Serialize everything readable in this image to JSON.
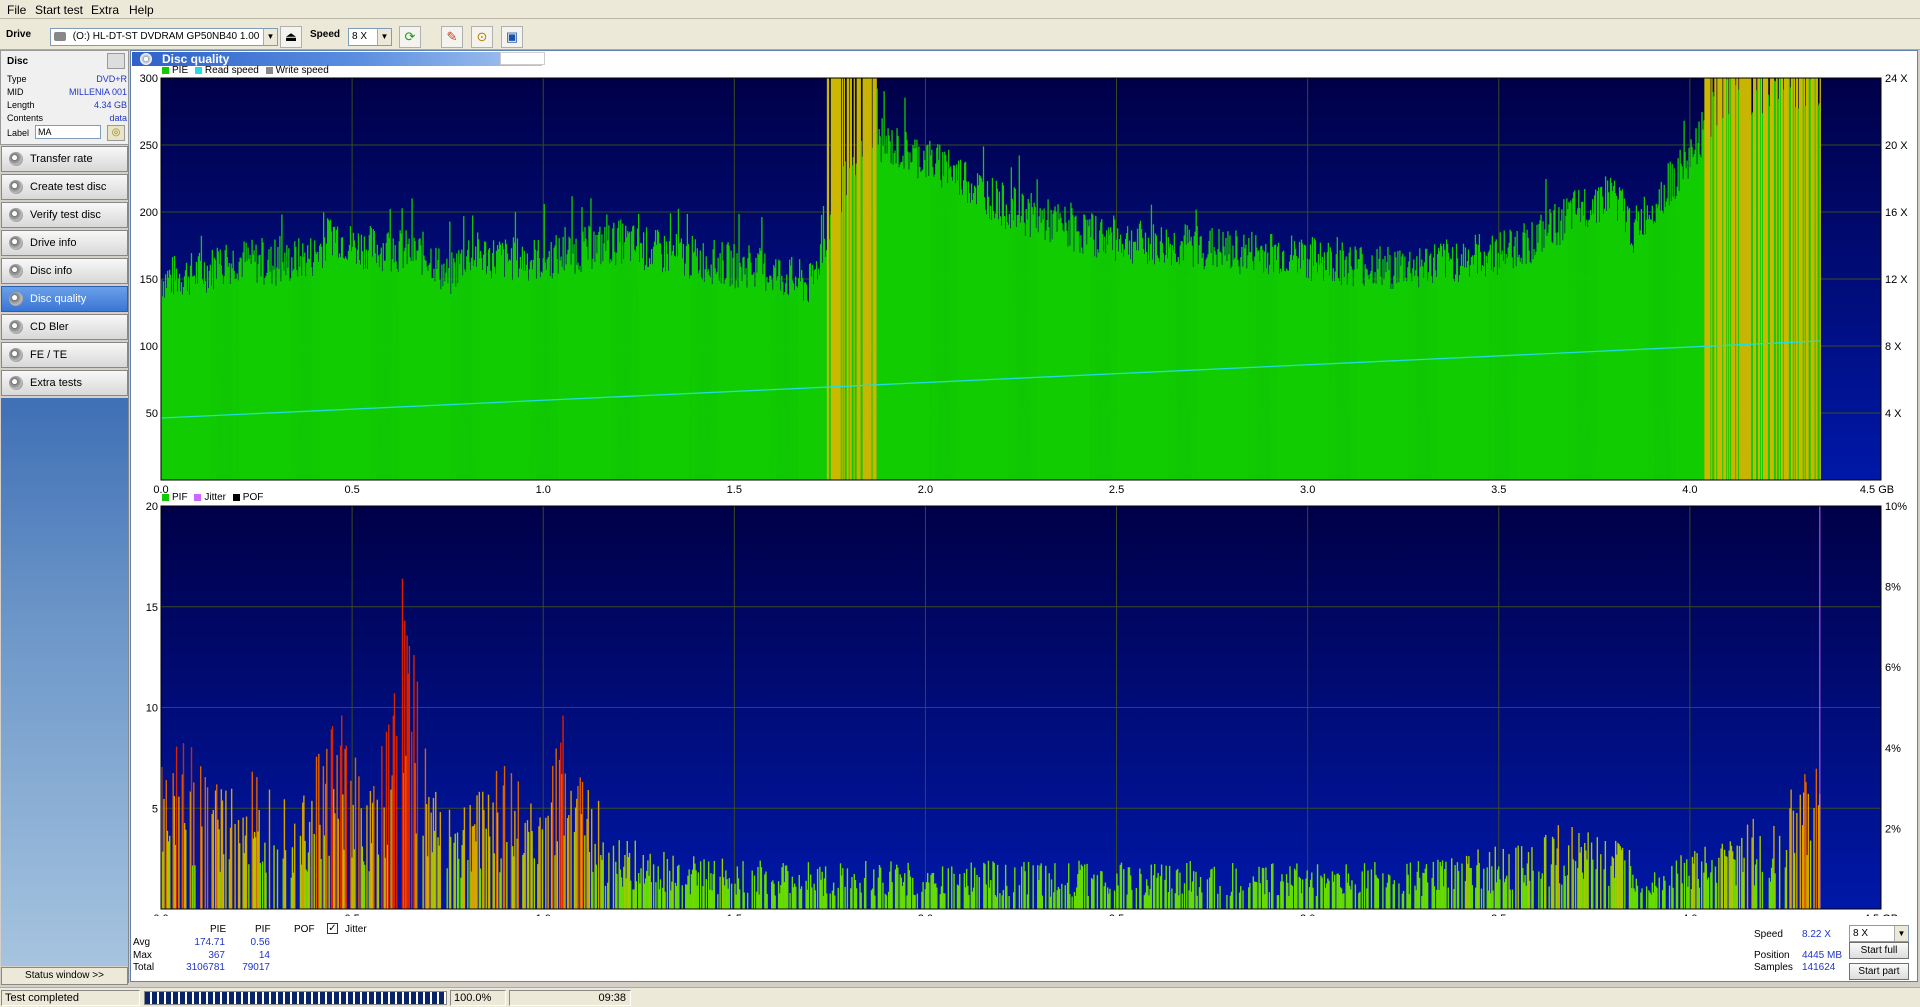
{
  "menu": {
    "file": "File",
    "start_test": "Start test",
    "extra": "Extra",
    "help": "Help"
  },
  "toolbar": {
    "drive_label": "Drive",
    "drive_value": "(O:)   HL-DT-ST DVDRAM GP50NB40 1.00",
    "speed_label": "Speed",
    "speed_value": "8 X"
  },
  "disc": {
    "header": "Disc",
    "rows": [
      {
        "key": "Type",
        "value": "DVD+R"
      },
      {
        "key": "MID",
        "value": "MILLENIA 001"
      },
      {
        "key": "Length",
        "value": "4.34 GB"
      },
      {
        "key": "Contents",
        "value": "data"
      }
    ],
    "label_key": "Label",
    "label_value": "MA"
  },
  "nav": [
    {
      "label": "Transfer rate",
      "active": false
    },
    {
      "label": "Create test disc",
      "active": false
    },
    {
      "label": "Verify test disc",
      "active": false
    },
    {
      "label": "Drive info",
      "active": false
    },
    {
      "label": "Disc info",
      "active": false
    },
    {
      "label": "Disc quality",
      "active": true
    },
    {
      "label": "CD Bler",
      "active": false
    },
    {
      "label": "FE / TE",
      "active": false
    },
    {
      "label": "Extra tests",
      "active": false
    }
  ],
  "status_window": "Status window >>",
  "panel_title": "Disc quality",
  "legend_top": [
    "PIE",
    "Read speed",
    "Write speed"
  ],
  "legend_bottom": [
    "PIF",
    "Jitter",
    "POF"
  ],
  "colors": {
    "pie": "#11cc00",
    "speed": "#22dddd",
    "write": "#888888",
    "bg": "#00005a",
    "pif_low": "#66dd00",
    "pif_high": "#dd2200",
    "jitter": "#cc66ff",
    "pof": "#000000",
    "yellow": "#ccb800"
  },
  "chart_data": [
    {
      "type": "area",
      "title": "PIE / Read speed",
      "x_ticks": [
        "0.0",
        "0.5",
        "1.0",
        "1.5",
        "2.0",
        "2.5",
        "3.0",
        "3.5",
        "4.0",
        "4.5 GB"
      ],
      "y_ticks_left": [
        "50",
        "100",
        "150",
        "200",
        "250",
        "300"
      ],
      "y_ticks_right": [
        "4 X",
        "8 X",
        "12 X",
        "16 X",
        "20 X",
        "24 X"
      ],
      "xlim": [
        0,
        4.5
      ],
      "ylim": [
        0,
        300
      ],
      "y2lim": [
        0,
        24
      ],
      "series": [
        {
          "name": "PIE",
          "x": [
            0.0,
            0.1,
            0.2,
            0.3,
            0.4,
            0.45,
            0.5,
            0.6,
            0.7,
            0.75,
            0.8,
            0.9,
            1.0,
            1.1,
            1.2,
            1.3,
            1.4,
            1.5,
            1.6,
            1.7,
            1.75,
            1.8,
            1.85,
            1.9,
            1.95,
            2.0,
            2.1,
            2.2,
            2.3,
            2.4,
            2.5,
            2.6,
            2.7,
            2.8,
            2.9,
            3.0,
            3.1,
            3.2,
            3.3,
            3.4,
            3.5,
            3.6,
            3.7,
            3.8,
            3.85,
            3.9,
            4.0,
            4.05,
            4.1,
            4.2,
            4.3,
            4.34
          ],
          "values": [
            150,
            155,
            165,
            160,
            168,
            185,
            175,
            172,
            168,
            150,
            170,
            165,
            165,
            172,
            178,
            170,
            165,
            160,
            155,
            145,
            195,
            230,
            260,
            250,
            245,
            240,
            225,
            205,
            195,
            185,
            180,
            175,
            175,
            170,
            170,
            165,
            162,
            158,
            160,
            165,
            170,
            180,
            200,
            215,
            185,
            205,
            240,
            270,
            285,
            290,
            290,
            285
          ]
        },
        {
          "name": "Read speed",
          "x": [
            0.0,
            4.34
          ],
          "values": [
            3.7,
            8.3
          ]
        }
      ],
      "yellow_regions_gb": [
        [
          1.74,
          1.87
        ],
        [
          4.03,
          4.34
        ]
      ]
    },
    {
      "type": "bar",
      "title": "PIF / Jitter",
      "x_ticks": [
        "0.0",
        "0.5",
        "1.0",
        "1.5",
        "2.0",
        "2.5",
        "3.0",
        "3.5",
        "4.0",
        "4.5 GB"
      ],
      "y_ticks_left": [
        "5",
        "10",
        "15",
        "20"
      ],
      "y_ticks_right": [
        "2%",
        "4%",
        "6%",
        "8%",
        "10%"
      ],
      "xlim": [
        0,
        4.5
      ],
      "ylim": [
        0,
        20
      ],
      "series": [
        {
          "name": "PIF",
          "x": [
            0.0,
            0.05,
            0.15,
            0.25,
            0.35,
            0.42,
            0.47,
            0.55,
            0.6,
            0.63,
            0.7,
            0.8,
            0.9,
            1.0,
            1.05,
            1.09,
            1.15,
            1.2,
            1.5,
            1.8,
            2.1,
            2.4,
            2.7,
            3.0,
            3.3,
            3.6,
            3.7,
            3.9,
            4.1,
            4.25,
            4.3
          ],
          "values": [
            6,
            8,
            5,
            6,
            5,
            7,
            9,
            5,
            9,
            14,
            6,
            5,
            6,
            5,
            8,
            9,
            4,
            3,
            2,
            2,
            2,
            2,
            2,
            2,
            2,
            3,
            4,
            2,
            3,
            5,
            6
          ]
        }
      ],
      "jitter_marker_gb": 4.34
    }
  ],
  "stats": {
    "col_pie": "PIE",
    "col_pif": "PIF",
    "col_pof": "POF",
    "jitter_label": "Jitter",
    "jitter_checked": true,
    "rows": [
      {
        "label": "Avg",
        "pie": "174.71",
        "pif": "0.56"
      },
      {
        "label": "Max",
        "pie": "367",
        "pif": "14"
      },
      {
        "label": "Total",
        "pie": "3106781",
        "pif": "79017"
      }
    ]
  },
  "run_info": {
    "speed_label": "Speed",
    "speed_value": "8.22 X",
    "position_label": "Position",
    "position_value": "4445 MB",
    "samples_label": "Samples",
    "samples_value": "141624",
    "speed_select": "8 X",
    "start_full": "Start full",
    "start_part": "Start part"
  },
  "statusbar": {
    "text": "Test completed",
    "progress_percent": "100.0%",
    "progress_value": 1.0,
    "time": "09:38"
  }
}
